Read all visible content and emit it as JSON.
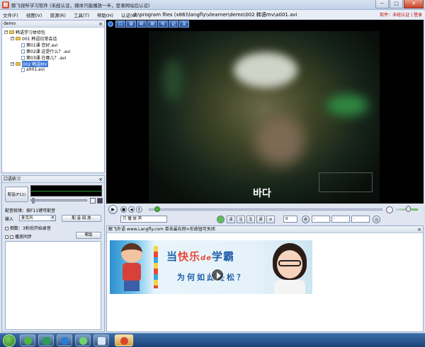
{
  "window": {
    "title": "鲸飞视听学习软件 (未经认证，媒体只能播放一半，登录网站后认证)",
    "controls": {
      "minimize": "─",
      "maximize": "□",
      "close": "✕"
    }
  },
  "menubar": {
    "items": [
      "文件(F)",
      "视图(V)",
      "资源(R)",
      "工具(T)",
      "帮助(H)",
      "认证(G)"
    ],
    "file_path": "d:\\program files (x86)\\langfly\\vlearner\\demo\\002 韩语mv\\a001.avi",
    "status": "软件：未经认证 | 登录"
  },
  "tree_panel": {
    "header": "demo",
    "close": "×",
    "nodes": [
      {
        "label": "韩语学习体验包",
        "level": 0,
        "type": "folder",
        "expander": "−"
      },
      {
        "label": "001 韩语日常会话",
        "level": 1,
        "type": "folder",
        "expander": "−"
      },
      {
        "label": "第01课 您好.avi",
        "level": 2,
        "type": "file"
      },
      {
        "label": "第02课 这是什么？.avi",
        "level": 2,
        "type": "file"
      },
      {
        "label": "第03课 在哪儿？.avi",
        "level": 2,
        "type": "file"
      },
      {
        "label": "002 韩语MV",
        "level": 1,
        "type": "folder",
        "expander": "−",
        "selected": true
      },
      {
        "label": "a001.avi",
        "level": 2,
        "type": "file"
      }
    ]
  },
  "oral_panel": {
    "header": "口语练习",
    "close": "×",
    "record_label": "配音(F11)",
    "status_label": "配音就绪：按F11键可配音",
    "input_label": "输入",
    "input_device": "麦克风",
    "dub_button": "配 音 回 放",
    "countdown_label": "倒数：3秒后开始录音",
    "sync_label": "播放同步",
    "help_button": "帮助"
  },
  "video": {
    "toolbar_buttons": [
      "口",
      "读",
      "听",
      "测",
      "写",
      "记",
      "文"
    ],
    "subtitle": "바다"
  },
  "playback": {
    "mode_select": "只 播 放 声",
    "mode_buttons": [
      "译",
      "注",
      "生",
      "读",
      "⊘"
    ],
    "speed_value": "0",
    "select_a": "-",
    "select_b": "-",
    "select_c": "-",
    "progress_fraction": 0.03,
    "volume_fraction": 0.55
  },
  "lower_panel": {
    "header": "鲸飞外语 www.Langfly.com 单击最右侧×形按钮可关闭",
    "close": "×",
    "banner": {
      "main_prefix": "当",
      "main_highlight": "快乐",
      "main_mid": "de",
      "main_suffix": "学霸",
      "sub": "为何如此轻松？"
    }
  },
  "taskbar": {
    "apps": [
      "ie",
      "media",
      "browser",
      "chat",
      "notes",
      "langfly"
    ],
    "clock": ""
  }
}
